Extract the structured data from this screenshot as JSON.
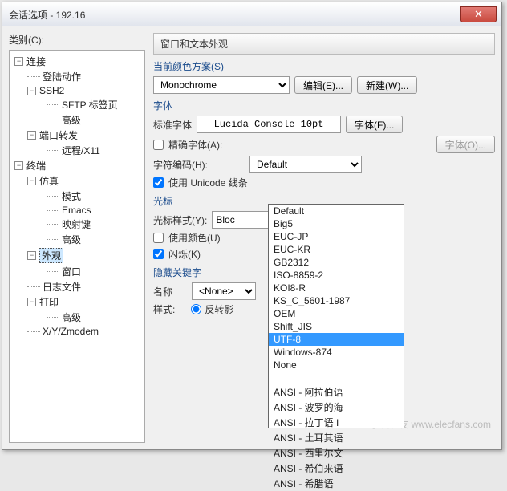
{
  "title": "会话选项 - 192.16",
  "sidebar_label": "类别(C):",
  "tree": {
    "connection": "连接",
    "login": "登陆动作",
    "ssh2": "SSH2",
    "sftp": "SFTP 标签页",
    "advanced1": "高级",
    "portfwd": "端口转发",
    "remote": "远程/X11",
    "terminal": "终端",
    "emulation": "仿真",
    "mode": "模式",
    "emacs": "Emacs",
    "mapkey": "映射键",
    "advanced2": "高级",
    "appearance": "外观",
    "window": "窗口",
    "logfile": "日志文件",
    "print": "打印",
    "advanced3": "高级",
    "xyz": "X/Y/Zmodem"
  },
  "header": "窗口和文本外观",
  "scheme": {
    "label": "当前颜色方案(S)",
    "value": "Monochrome",
    "edit": "编辑(E)...",
    "new": "新建(W)..."
  },
  "font": {
    "group": "字体",
    "std_label": "标准字体",
    "display": "Lucida Console 10pt",
    "btn": "字体(F)...",
    "precise": "精确字体(A):",
    "btn2": "字体(O)..."
  },
  "encoding": {
    "label": "字符编码(H):",
    "value": "Default",
    "unicode": "使用 Unicode 线条",
    "options": [
      "Default",
      "Big5",
      "EUC-JP",
      "EUC-KR",
      "GB2312",
      "ISO-8859-2",
      "KOI8-R",
      "KS_C_5601-1987",
      "OEM",
      "Shift_JIS",
      "UTF-8",
      "Windows-874",
      "None",
      "",
      "ANSI - 阿拉伯语",
      "ANSI - 波罗的海",
      "ANSI - 拉丁语 I",
      "ANSI - 土耳其语",
      "ANSI - 西里尔文",
      "ANSI - 希伯来语",
      "ANSI - 希腊语"
    ]
  },
  "cursor": {
    "group": "光标",
    "style_label": "光标样式(Y):",
    "style_value": "Bloc",
    "usecolor": "使用颜色(U)",
    "blink": "闪烁(K)"
  },
  "hiddenkw": {
    "group": "隐藏关键字",
    "name_label": "名称",
    "name_value": "<None>",
    "style_label": "样式:",
    "style_radio": "反转影"
  },
  "watermark": "电子发烧友\nwww.elecfans.com"
}
